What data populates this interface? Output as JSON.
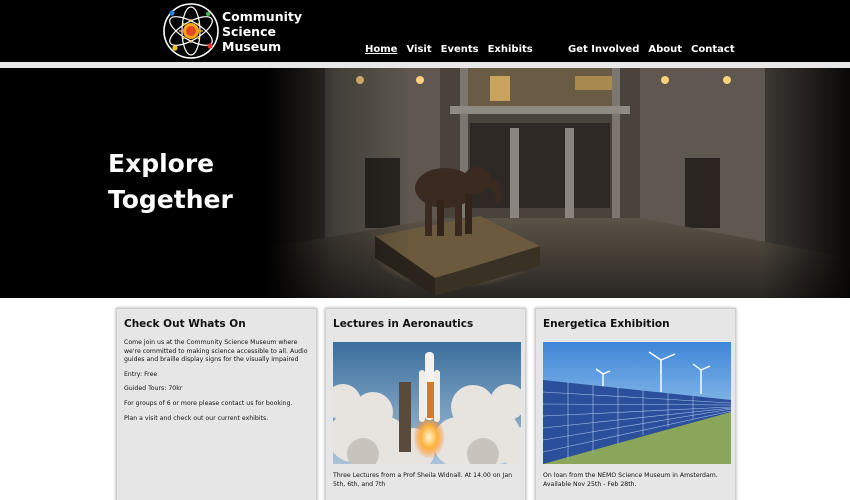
{
  "header": {
    "brand": [
      "Community",
      "Science",
      "Museum"
    ],
    "nav_left": [
      "Home",
      "Visit",
      "Events",
      "Exhibits"
    ],
    "nav_right": [
      "Get Involved",
      "About",
      "Contact"
    ],
    "active_nav": "Home"
  },
  "hero": {
    "title_lines": [
      "Explore",
      "Together"
    ]
  },
  "cards": {
    "whats_on": {
      "title": "Check Out Whats On",
      "paragraphs": [
        "Come join us at the Community Science Museum where we're committed to making science accessible to all. Audio guides and braille display signs for the visually impaired",
        "Entry: Free",
        "Guided Tours: 70kr",
        "For groups of 6 or more please contact us for booking.",
        "Plan a visit and check out our current exhibits."
      ]
    },
    "aeronautics": {
      "title": "Lectures in Aeronautics",
      "caption": "Three Lectures from a Prof Sheila Widnall. At 14.00 on Jan 5th, 6th, and 7th"
    },
    "energetica": {
      "title": "Energetica Exhibition",
      "caption": "On loan from the NEMO Science Museum in Amsterdam. Available Nov 25th - Feb 28th."
    }
  },
  "colors": {
    "header_bg": "#000000",
    "button": "#5b2ac0",
    "card_bg": "#e6e6e6"
  }
}
